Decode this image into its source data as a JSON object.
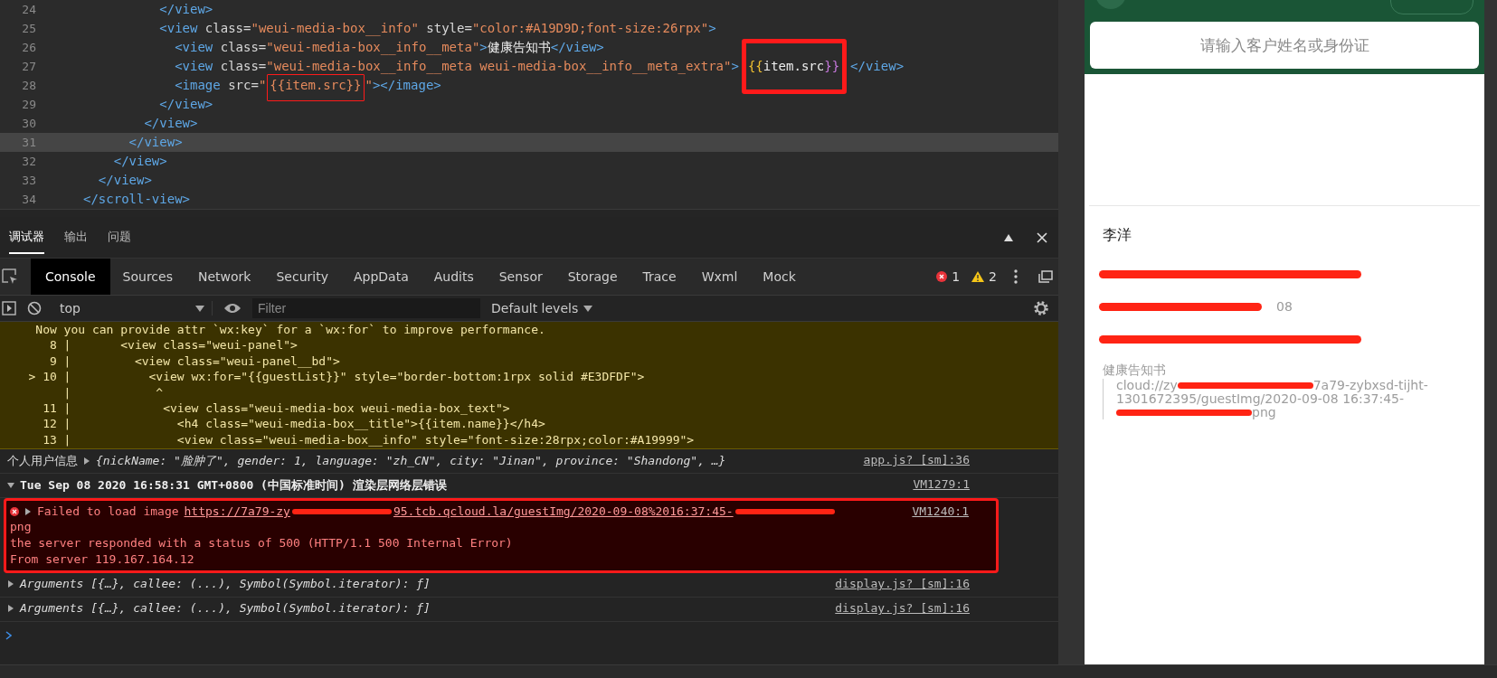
{
  "editor": {
    "lines": [
      {
        "num": "24",
        "current": false,
        "tokens": [
          {
            "kind": "tag",
            "text": "          </view>"
          }
        ]
      },
      {
        "num": "25",
        "current": false,
        "tokens": [
          {
            "kind": "tag",
            "text": "          <view"
          },
          {
            "kind": "attr",
            "text": " class="
          },
          {
            "kind": "str",
            "text": "\"weui-media-box__info\""
          },
          {
            "kind": "attr",
            "text": " style="
          },
          {
            "kind": "str",
            "text": "\"color:#A19D9D;font-size:26rpx\""
          },
          {
            "kind": "tag",
            "text": ">"
          }
        ]
      },
      {
        "num": "26",
        "current": false,
        "tokens": [
          {
            "kind": "tag",
            "text": "            <view"
          },
          {
            "kind": "attr",
            "text": " class="
          },
          {
            "kind": "str",
            "text": "\"weui-media-box__info__meta\""
          },
          {
            "kind": "tag",
            "text": ">"
          },
          {
            "kind": "text",
            "text": "健康告知书"
          },
          {
            "kind": "tag",
            "text": "</view>"
          }
        ]
      },
      {
        "num": "27",
        "current": false,
        "tokens": [
          {
            "kind": "tag",
            "text": "            <view"
          },
          {
            "kind": "attr",
            "text": " class="
          },
          {
            "kind": "str",
            "text": "\"weui-media-box__info__meta weui-media-box__info__meta_extra\""
          },
          {
            "kind": "tag",
            "text": ">"
          },
          {
            "kind": "thick-frame",
            "tokens": [
              {
                "kind": "brace",
                "text": "{{"
              },
              {
                "kind": "text",
                "text": "item.src"
              },
              {
                "kind": "brace2",
                "text": "}}"
              }
            ]
          },
          {
            "kind": "tag",
            "text": "</view>"
          }
        ]
      },
      {
        "num": "28",
        "current": false,
        "tokens": [
          {
            "kind": "tag",
            "text": "            <image"
          },
          {
            "kind": "attr",
            "text": " src="
          },
          {
            "kind": "str",
            "text": "\""
          },
          {
            "kind": "thin-frame",
            "tokens": [
              {
                "kind": "str",
                "text": "{{item.src}}"
              }
            ]
          },
          {
            "kind": "str",
            "text": "\""
          },
          {
            "kind": "tag",
            "text": "></image>"
          }
        ]
      },
      {
        "num": "29",
        "current": false,
        "tokens": [
          {
            "kind": "tag",
            "text": "          </view>"
          }
        ]
      },
      {
        "num": "30",
        "current": false,
        "tokens": [
          {
            "kind": "tag",
            "text": "        </view>"
          }
        ]
      },
      {
        "num": "31",
        "current": true,
        "tokens": [
          {
            "kind": "tag",
            "text": "      </view>"
          }
        ]
      },
      {
        "num": "32",
        "current": false,
        "tokens": [
          {
            "kind": "tag",
            "text": "    </view>"
          }
        ]
      },
      {
        "num": "33",
        "current": false,
        "tokens": [
          {
            "kind": "tag",
            "text": "  </view>"
          }
        ]
      },
      {
        "num": "34",
        "current": false,
        "tokens": [
          {
            "kind": "tag",
            "text": "</scroll-view>"
          }
        ]
      }
    ]
  },
  "devtools": {
    "top_tabs": [
      {
        "label": "调试器",
        "selected": true
      },
      {
        "label": "输出",
        "selected": false
      },
      {
        "label": "问题",
        "selected": false
      }
    ],
    "panel_tabs": [
      {
        "label": "Console",
        "selected": true
      },
      {
        "label": "Sources",
        "selected": false
      },
      {
        "label": "Network",
        "selected": false
      },
      {
        "label": "Security",
        "selected": false
      },
      {
        "label": "AppData",
        "selected": false
      },
      {
        "label": "Audits",
        "selected": false
      },
      {
        "label": "Sensor",
        "selected": false
      },
      {
        "label": "Storage",
        "selected": false
      },
      {
        "label": "Trace",
        "selected": false
      },
      {
        "label": "Wxml",
        "selected": false
      },
      {
        "label": "Mock",
        "selected": false
      }
    ],
    "error_count": "1",
    "warning_count": "2",
    "context": "top",
    "filter": {
      "placeholder": "Filter"
    },
    "levels": "Default levels",
    "console": [
      {
        "kind": "warning",
        "lines": [
          "    Now you can provide attr `wx:key` for a `wx:for` to improve performance.",
          "      8 |       <view class=\"weui-panel\">",
          "      9 |         <view class=\"weui-panel__bd\">",
          "   > 10 |           <view wx:for=\"{{guestList}}\" style=\"border-bottom:1rpx solid #E3DFDF\">",
          "        |            ^",
          "     11 |             <view class=\"weui-media-box weui-media-box_text\">",
          "     12 |               <h4 class=\"weui-media-box__title\">{{item.name}}</h4>",
          "     13 |               <view class=\"weui-media-box__info\" style=\"font-size:28rpx;color:#A19999\">"
        ]
      },
      {
        "kind": "log",
        "label": "个人用户信息",
        "object": "{nickName: \"脸肿了\", gender: 1, language: \"zh_CN\", city: \"Jinan\", province: \"Shandong\", …}",
        "source": "app.js? [sm]:36"
      },
      {
        "kind": "group",
        "text": "Tue Sep 08 2020 16:58:31 GMT+0800 (中国标准时间) 渲染层网络层错误",
        "source": "VM1279:1",
        "expanded": true
      },
      {
        "kind": "error",
        "framed": true,
        "message": "Failed to load image",
        "url_parts": [
          {
            "kind": "text",
            "text": "https://7a79-zy"
          },
          {
            "kind": "scribble"
          },
          {
            "kind": "text",
            "text": "95.tcb.qcloud.la/guestImg/2020-09-08%2016:37:45-"
          },
          {
            "kind": "scribble"
          }
        ],
        "lines": [
          "png",
          "the server responded with a status of 500 (HTTP/1.1 500 Internal Error)",
          "From server 119.167.164.12"
        ],
        "source": "VM1240:1"
      },
      {
        "kind": "args",
        "text": "Arguments [{…}, callee: (...), Symbol(Symbol.iterator): ƒ]",
        "source": "display.js? [sm]:16"
      },
      {
        "kind": "args",
        "text": "Arguments [{…}, callee: (...), Symbol(Symbol.iterator): ƒ]",
        "source": "display.js? [sm]:16"
      }
    ]
  },
  "phone": {
    "search": {
      "placeholder": "请输入客户姓名或身份证"
    },
    "name": "李洋",
    "rows": [
      {
        "redacted": true
      },
      {
        "redacted": true,
        "text": "08"
      },
      {
        "redacted": true
      }
    ],
    "notice_label": "健康告知书",
    "src_parts": [
      {
        "kind": "text",
        "text": "cloud://zy"
      },
      {
        "kind": "scribble"
      },
      {
        "kind": "text",
        "text": "7a79-zybxsd-tijht-"
      },
      {
        "kind": "break"
      },
      {
        "kind": "text",
        "text": "1301672395/guestImg/2020-09-08 16:37:45-"
      },
      {
        "kind": "break"
      },
      {
        "kind": "scribble"
      },
      {
        "kind": "text",
        "text": "png"
      }
    ]
  }
}
